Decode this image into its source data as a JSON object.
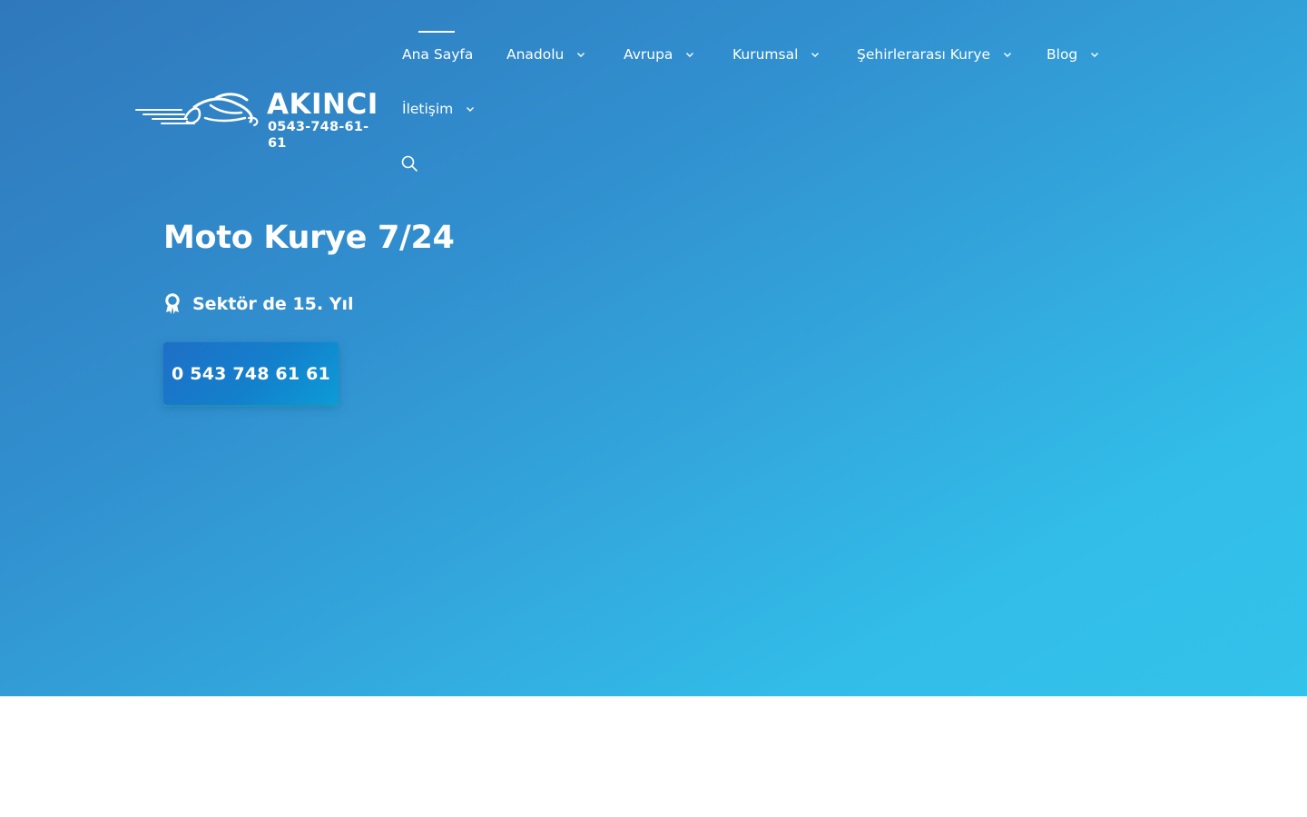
{
  "logo": {
    "name": "AKINCI",
    "phone": "0543-748-61-61",
    "icon": "motorcycle-logo-icon"
  },
  "nav": {
    "items": [
      {
        "label": "Ana Sayfa",
        "active": true,
        "has_dropdown": false
      },
      {
        "label": "Anadolu",
        "has_dropdown": true
      },
      {
        "label": "Avrupa",
        "has_dropdown": true
      },
      {
        "label": "Kurumsal",
        "has_dropdown": true
      },
      {
        "label": "Şehirlerarası Kurye",
        "has_dropdown": true
      },
      {
        "label": "Blog",
        "has_dropdown": true
      },
      {
        "label": "İletişim",
        "has_dropdown": true
      }
    ],
    "search_icon": "search-icon"
  },
  "hero": {
    "title": "Moto Kurye 7/24",
    "badge_text": "Sektör de 15. Yıl",
    "badge_icon": "award-icon",
    "cta_label": "0 543 748 61 61"
  },
  "colors": {
    "gradient_start": "#2f78bb",
    "gradient_end": "#33c2ea",
    "cta": "#1380cc",
    "text": "#ffffff"
  }
}
